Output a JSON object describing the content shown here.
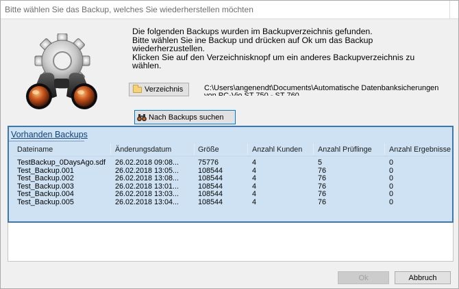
{
  "window": {
    "title": "Bitte wählen Sie das Backup, welches Sie wiederherstellen möchten"
  },
  "intro": {
    "line1": "Die folgenden Backups wurden im Backupverzeichnis gefunden.",
    "line2": "Bitte wählen Sie ine Backup und drücken auf Ok um das Backup wiederherzustellen.",
    "line3": "Klicken Sie auf den Verzeichnisknopf um ein anderes Backupverzeichnis zu wählen."
  },
  "directory": {
    "button_label": "Verzeichnis",
    "path": "C:\\Users\\angenendt\\Documents\\Automatische Datenbanksicherungen von PC-Vio ST 750 - ST 760"
  },
  "search": {
    "button_label": "Nach Backups suchen"
  },
  "backups": {
    "group_title": "Vorhanden Backups",
    "columns": [
      "Dateiname",
      "Änderungsdatum",
      "Größe",
      "Anzahl Kunden",
      "Anzahl Prüflinge",
      "Anzahl Ergebnisse"
    ],
    "rows": [
      [
        "TestBackup_0DaysAgo.sdf",
        "26.02.2018 09:08...",
        "75776",
        "4",
        "5",
        "0"
      ],
      [
        "Test_Backup.001",
        "26.02.2018 13:05...",
        "108544",
        "4",
        "76",
        "0"
      ],
      [
        "Test_Backup.002",
        "26.02.2018 13:08...",
        "108544",
        "4",
        "76",
        "0"
      ],
      [
        "Test_Backup.003",
        "26.02.2018 13:01...",
        "108544",
        "4",
        "76",
        "0"
      ],
      [
        "Test_Backup.004",
        "26.02.2018 13:03...",
        "108544",
        "4",
        "76",
        "0"
      ],
      [
        "Test_Backup.005",
        "26.02.2018 13:04...",
        "108544",
        "4",
        "76",
        "0"
      ]
    ]
  },
  "footer": {
    "ok_label": "Ok",
    "cancel_label": "Abbruch"
  },
  "icons": {
    "logo": "gear-binoculars-icon",
    "directory": "folder-icon",
    "search": "binoculars-icon"
  }
}
